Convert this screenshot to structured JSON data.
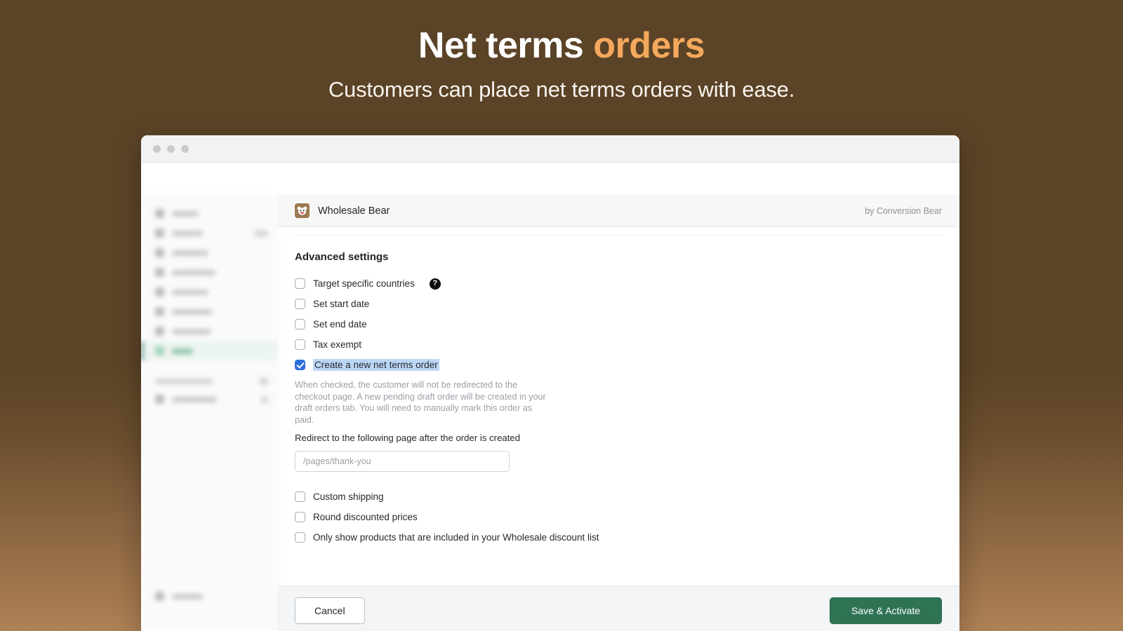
{
  "hero": {
    "title_main": "Net terms ",
    "title_accent": "orders",
    "subtitle": "Customers can place net terms orders with ease.",
    "accent_color": "#f4a95c",
    "background_top": "#5b4327",
    "background_bottom": "#ad8256"
  },
  "window": {
    "traffic_lights": [
      "close-dot",
      "minimize-dot",
      "maximize-dot"
    ]
  },
  "sidebar": {
    "items": [
      {
        "label": "Home",
        "badge": ""
      },
      {
        "label": "Orders",
        "badge": "12"
      },
      {
        "label": "Products",
        "badge": ""
      },
      {
        "label": "Customers",
        "badge": ""
      },
      {
        "label": "Analytics",
        "badge": ""
      },
      {
        "label": "Marketing",
        "badge": ""
      },
      {
        "label": "Discounts",
        "badge": ""
      },
      {
        "label": "Apps",
        "badge": "",
        "active": true
      }
    ],
    "section_label": "SALES CHANNELS",
    "channels": [
      {
        "label": "Online Store"
      }
    ],
    "bottom_item": {
      "label": "Settings"
    }
  },
  "app": {
    "name": "Wholesale Bear",
    "author": "by Conversion Bear",
    "icon": "bear-face-icon",
    "section_title": "Advanced settings",
    "options": [
      {
        "label": "Target specific countries",
        "checked": false,
        "help": true
      },
      {
        "label": "Set start date",
        "checked": false,
        "help": false
      },
      {
        "label": "Set end date",
        "checked": false,
        "help": false
      },
      {
        "label": "Tax exempt",
        "checked": false,
        "help": false
      },
      {
        "label": "Create a new net terms order",
        "checked": true,
        "help": false,
        "selected": true
      }
    ],
    "help_text": "When checked, the customer will not be redirected to the checkout page. A new pending draft order will be created in your draft orders tab. You will need to manually mark this order as paid.",
    "redirect_label": "Redirect to the following page after the order is created",
    "redirect_value": "",
    "redirect_placeholder": "/pages/thank-you",
    "options_bottom": [
      {
        "label": "Custom shipping",
        "checked": false
      },
      {
        "label": "Round discounted prices",
        "checked": false
      },
      {
        "label": "Only show products that are included in your Wholesale discount list",
        "checked": false
      }
    ],
    "footer": {
      "cancel_label": "Cancel",
      "save_label": "Save & Activate",
      "save_color": "#2f7355"
    },
    "help_icon_glyph": "?"
  }
}
